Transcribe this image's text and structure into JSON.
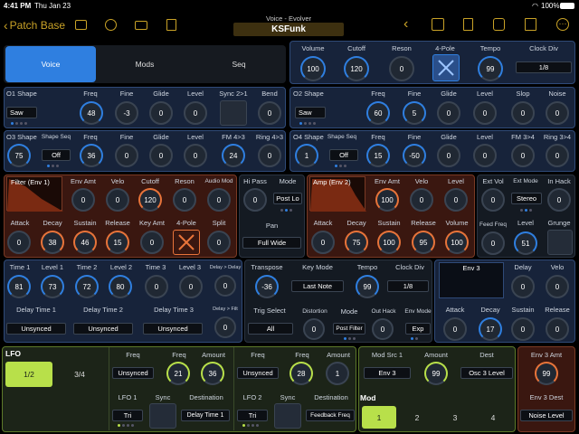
{
  "status": {
    "time": "4:41 PM",
    "date": "Thu Jan 23",
    "battery": "100%"
  },
  "nav": {
    "back": "Patch Base",
    "subtitle": "Voice - Evolver",
    "patch": "KSFunk"
  },
  "tabs": [
    "Voice",
    "Mods",
    "Seq"
  ],
  "top": {
    "volume_l": "Volume",
    "volume": "100",
    "cutoff_l": "Cutoff",
    "cutoff": "120",
    "reson_l": "Reson",
    "reson": "0",
    "pole_l": "4-Pole",
    "tempo_l": "Tempo",
    "tempo": "99",
    "clockdiv_l": "Clock Div",
    "clockdiv": "1/8"
  },
  "o1": {
    "shape_l": "O1 Shape",
    "shape": "Saw",
    "freq_l": "Freq",
    "freq": "48",
    "fine_l": "Fine",
    "fine": "-3",
    "glide_l": "Glide",
    "glide": "0",
    "level_l": "Level",
    "level": "0",
    "sync_l": "Sync 2>1",
    "bend_l": "Bend",
    "bend": "0"
  },
  "o2": {
    "shape_l": "O2 Shape",
    "shape": "Saw",
    "freq_l": "Freq",
    "freq": "60",
    "fine_l": "Fine",
    "fine": "5",
    "glide_l": "Glide",
    "glide": "0",
    "level_l": "Level",
    "level": "0",
    "slop_l": "Slop",
    "slop": "0",
    "noise_l": "Noise",
    "noise": "0"
  },
  "o3": {
    "shape_l": "O3 Shape",
    "shape": "75",
    "seq_l": "Shape Seq",
    "seq": "Off",
    "freq_l": "Freq",
    "freq": "36",
    "fine_l": "Fine",
    "fine": "0",
    "glide_l": "Glide",
    "glide": "0",
    "level_l": "Level",
    "level": "0",
    "fm_l": "FM 4>3",
    "fm": "24",
    "ring_l": "Ring 4>3",
    "ring": "0"
  },
  "o4": {
    "shape_l": "O4 Shape",
    "shape": "1",
    "seq_l": "Shape Seq",
    "seq": "Off",
    "freq_l": "Freq",
    "freq": "15",
    "fine_l": "Fine",
    "fine": "-50",
    "glide_l": "Glide",
    "glide": "0",
    "level_l": "Level",
    "level": "0",
    "fm_l": "FM 3>4",
    "fm": "0",
    "ring_l": "Ring 3>4",
    "ring": "0"
  },
  "filter": {
    "title": "Filter (Env 1)",
    "envamt_l": "Env Amt",
    "envamt": "0",
    "velo_l": "Velo",
    "velo": "0",
    "cutoff_l": "Cutoff",
    "cutoff": "120",
    "reson_l": "Reson",
    "reson": "0",
    "audiomod_l": "Audio Mod",
    "audiomod": "0",
    "attack_l": "Attack",
    "attack": "0",
    "decay_l": "Decay",
    "decay": "38",
    "sustain_l": "Sustain",
    "sustain": "46",
    "release_l": "Release",
    "release": "15",
    "keyamt_l": "Key Amt",
    "keyamt": "0",
    "pole_l": "4-Pole",
    "split_l": "Split",
    "split": "0"
  },
  "hipass": {
    "hp_l": "Hi Pass",
    "hp": "0",
    "mode_l": "Mode",
    "mode": "Post Lo",
    "pan_l": "Pan",
    "pan": "Full Wide"
  },
  "amp": {
    "title": "Amp (Env 2)",
    "envamt_l": "Env Amt",
    "envamt": "100",
    "velo_l": "Velo",
    "velo": "0",
    "level_l": "Level",
    "level": "0",
    "attack_l": "Attack",
    "attack": "0",
    "decay_l": "Decay",
    "decay": "75",
    "sustain_l": "Sustain",
    "sustain": "100",
    "release_l": "Release",
    "release": "95",
    "volume_l": "Volume",
    "volume": "100"
  },
  "ext": {
    "extvol_l": "Ext Vol",
    "extvol": "0",
    "extmode_l": "Ext Mode",
    "extmode": "Stereo",
    "inhack_l": "In Hack",
    "inhack": "0",
    "feed_l": "Feed Freq",
    "feed": "0",
    "level_l": "Level",
    "level": "51",
    "grunge_l": "Grunge"
  },
  "delay": {
    "t1_l": "Time 1",
    "t1": "81",
    "l1_l": "Level 1",
    "l1": "73",
    "t2_l": "Time 2",
    "t2": "72",
    "l2_l": "Level 2",
    "l2": "80",
    "t3_l": "Time 3",
    "t3": "0",
    "l3_l": "Level 3",
    "l3": "0",
    "dd_l": "Delay > Delay",
    "dd": "0",
    "df_l": "Delay > Filt",
    "df": "0",
    "dt1_l": "Delay Time 1",
    "dt1": "Unsynced",
    "dt2_l": "Delay Time 2",
    "dt2": "Unsynced",
    "dt3_l": "Delay Time 3",
    "dt3": "Unsynced"
  },
  "misc": {
    "transpose_l": "Transpose",
    "transpose": "-36",
    "keymode_l": "Key Mode",
    "keymode": "Last Note",
    "tempo_l": "Tempo",
    "tempo": "99",
    "clockdiv_l": "Clock Div",
    "clockdiv": "1/8",
    "trig_l": "Trig Select",
    "trig": "All",
    "dist_l": "Distortion",
    "dist": "0",
    "mode_l": "Mode",
    "mode": "Post Filter",
    "outhack_l": "Out Hack",
    "outhack": "0",
    "envmode_l": "Env Mode",
    "envmode": "Exp"
  },
  "env3": {
    "title": "Env 3",
    "delay_l": "Delay",
    "delay": "0",
    "velo_l": "Velo",
    "velo": "0",
    "attack_l": "Attack",
    "attack": "0",
    "decay_l": "Decay",
    "decay": "17",
    "sustain_l": "Sustain",
    "sustain": "0",
    "release_l": "Release",
    "release": "0"
  },
  "lfo": {
    "title": "LFO",
    "tab1": "1/2",
    "tab2": "3/4",
    "l1": {
      "freq_l": "Freq",
      "sync": "Unsynced",
      "freq2_l": "Freq",
      "freq": "21",
      "amount_l": "Amount",
      "amount": "36",
      "name": "LFO 1",
      "shape": "Tri",
      "sync_l": "Sync",
      "dest_l": "Destination",
      "dest": "Delay Time 1"
    },
    "l2": {
      "freq_l": "Freq",
      "sync": "Unsynced",
      "freq2_l": "Freq",
      "freq": "28",
      "amount_l": "Amount",
      "amount": "1",
      "name": "LFO 2",
      "shape": "Tri",
      "sync_l": "Sync",
      "dest_l": "Destination",
      "dest": "Feedback Freq"
    }
  },
  "mod": {
    "src_l": "Mod Src 1",
    "src": "Env 3",
    "amount_l": "Amount",
    "amount": "99",
    "dest_l": "Dest",
    "dest": "Osc 3 Level",
    "title": "Mod",
    "tabs": [
      "1",
      "2",
      "3",
      "4"
    ]
  },
  "env3amt": {
    "amt_l": "Env 3 Amt",
    "amt": "99",
    "dest_l": "Env 3 Dest",
    "dest": "Noise Level"
  },
  "colors": {
    "blue": "#2f7fe0",
    "orange": "#e8743a",
    "green": "#b8e04a",
    "gold": "#c9a227"
  }
}
